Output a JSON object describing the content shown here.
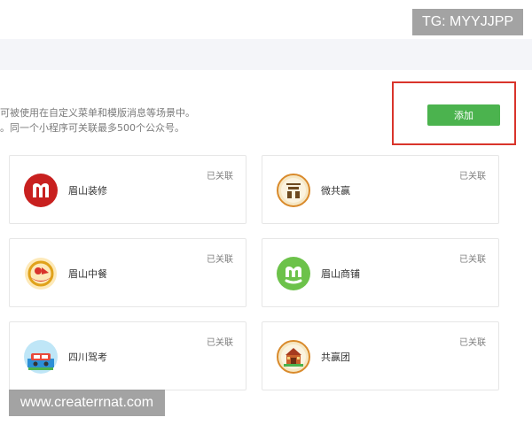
{
  "watermarks": {
    "tg": "TG: MYYJJPP",
    "url": "www.createrrnat.com"
  },
  "description": {
    "line1": "可被使用在自定义菜单和模版消息等场景中。",
    "line2": "。同一个小程序可关联最多500个公众号。"
  },
  "add_button": {
    "label": "添加"
  },
  "colors": {
    "accent": "#4bb34e",
    "highlight_border": "#d9342b"
  },
  "cards": [
    {
      "name": "眉山装修",
      "status": "已关联",
      "icon": "meishan-zhuangxiu-logo"
    },
    {
      "name": "微共赢",
      "status": "已关联",
      "icon": "wei-gongying-logo"
    },
    {
      "name": "眉山中餐",
      "status": "已关联",
      "icon": "meishan-zhongcan-logo"
    },
    {
      "name": "眉山商铺",
      "status": "已关联",
      "icon": "meishan-shangpu-logo"
    },
    {
      "name": "四川驾考",
      "status": "已关联",
      "icon": "sichuan-jiakao-logo"
    },
    {
      "name": "共赢团",
      "status": "已关联",
      "icon": "gongying-tuan-logo"
    }
  ]
}
